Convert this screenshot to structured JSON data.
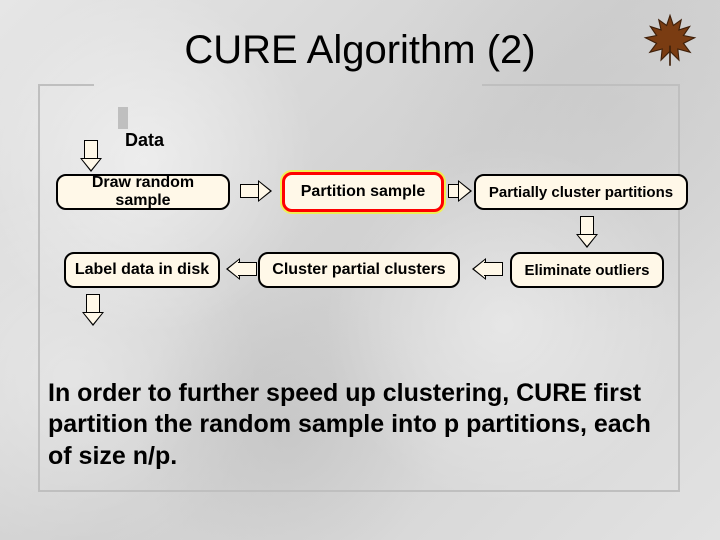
{
  "title": "CURE Algorithm (2)",
  "data_label": "Data",
  "boxes": {
    "b1": "Draw random sample",
    "b2": "Partition sample",
    "b3": "Partially cluster partitions",
    "b4": "Label data in disk",
    "b5": "Cluster partial clusters",
    "b6": "Eliminate outliers"
  },
  "highlighted_box": "b2",
  "body": "In order to further speed up clustering, CURE first partition the random sample into p partitions, each of size n/p.",
  "icon": "maple-leaf"
}
